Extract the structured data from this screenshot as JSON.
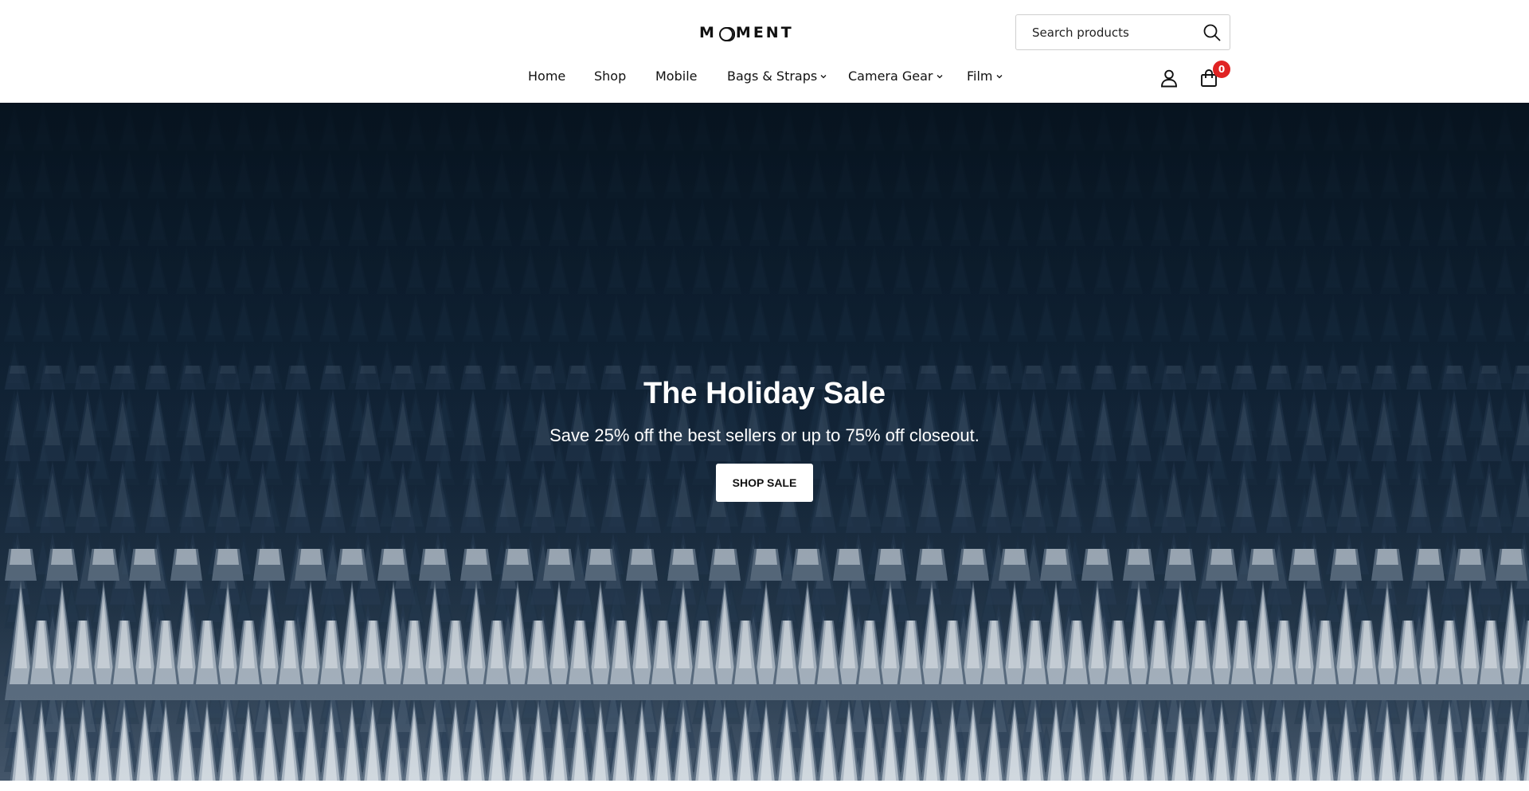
{
  "header": {
    "logo_text": "MOMENT",
    "search": {
      "placeholder": "Search products",
      "icon": "search-icon"
    },
    "nav": [
      {
        "label": "Home",
        "has_dropdown": false
      },
      {
        "label": "Shop",
        "has_dropdown": false
      },
      {
        "label": "Mobile",
        "has_dropdown": false
      },
      {
        "label": "Bags & Straps",
        "has_dropdown": true
      },
      {
        "label": "Camera Gear",
        "has_dropdown": true
      },
      {
        "label": "Film",
        "has_dropdown": true
      }
    ],
    "account_icon": "user-icon",
    "cart": {
      "icon": "shopping-bag-icon",
      "count": "0",
      "badge_color": "#e02323"
    }
  },
  "hero": {
    "title": "The Holiday Sale",
    "subtitle": "Save 25% off the best sellers or up to 75% off closeout.",
    "button_label": "SHOP SALE",
    "background": "snowy-pine-forest-at-night"
  }
}
